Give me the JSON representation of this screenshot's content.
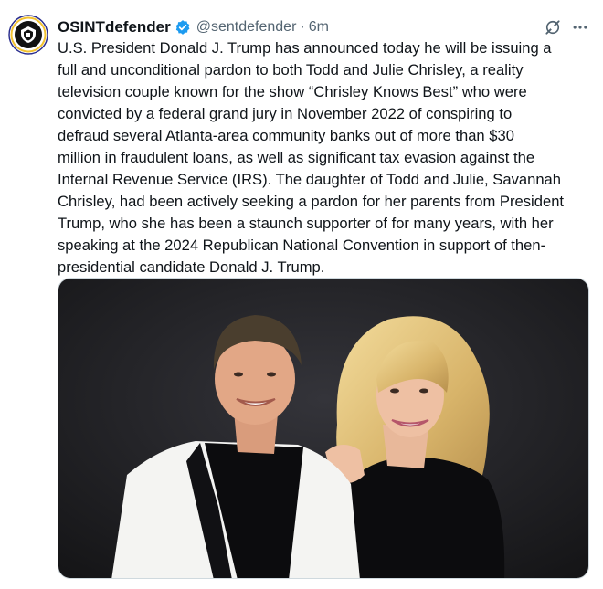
{
  "author": {
    "display_name": "OSINTdefender",
    "handle": "@sentdefender",
    "separator": "·",
    "time": "6m",
    "verified": true,
    "avatar_icon": "osint-defender-logo-icon"
  },
  "tweet": {
    "text_lines": [
      "U.S. President Donald J. Trump has announced today he will be issuing a",
      "full and unconditional pardon to both Todd and Julie Chrisley, a reality",
      "television couple known for the show “Chrisley Knows Best” who were",
      "convicted by a federal grand jury in November 2022 of conspiring to",
      "defraud several Atlanta-area community banks out of more than $30",
      "million in fraudulent loans, as well as significant tax evasion against the",
      "Internal Revenue Service (IRS). The daughter of Todd and Julie, Savannah",
      "Chrisley, had been actively seeking a pardon for her parents from President",
      "Trump, who she has been a staunch supporter of for many years, with her",
      "speaking at the 2024 Republican National Convention in support of then-",
      "presidential candidate Donald J. Trump."
    ]
  },
  "icons": {
    "verified": "verified-badge-icon",
    "grok": "grok-icon",
    "more": "more-options-icon"
  },
  "colors": {
    "text": "#0f1419",
    "secondary": "#536471",
    "verified_blue": "#1d9bf0",
    "media_background": "#1f1f22"
  }
}
